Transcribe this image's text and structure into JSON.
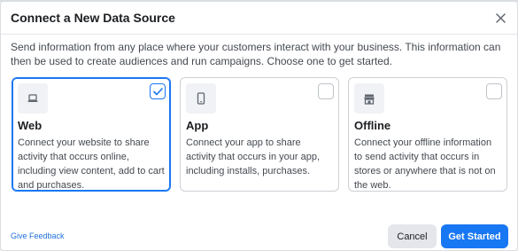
{
  "dialog": {
    "title": "Connect a New Data Source",
    "description": "Send information from any place where your customers interact with your business. This information can then be used to create audiences and run campaigns. Choose one to get started."
  },
  "options": [
    {
      "title": "Web",
      "text": "Connect your website to share activity that occurs online, including view content, add to cart and purchases.",
      "icon": "laptop-icon",
      "selected": true
    },
    {
      "title": "App",
      "text": "Connect your app to share activity that occurs in your app, including installs, purchases.",
      "icon": "mobile-phone-icon",
      "selected": false
    },
    {
      "title": "Offline",
      "text": "Connect your offline information to send activity that occurs in stores or anywhere that is not on the web.",
      "icon": "store-icon",
      "selected": false
    }
  ],
  "footer": {
    "feedback_label": "Give Feedback",
    "cancel_label": "Cancel",
    "start_label": "Get Started"
  },
  "colors": {
    "accent": "#1877f2",
    "link": "#216fdb",
    "border": "#ccd0d5",
    "icon_bg": "#f0f2f5"
  }
}
